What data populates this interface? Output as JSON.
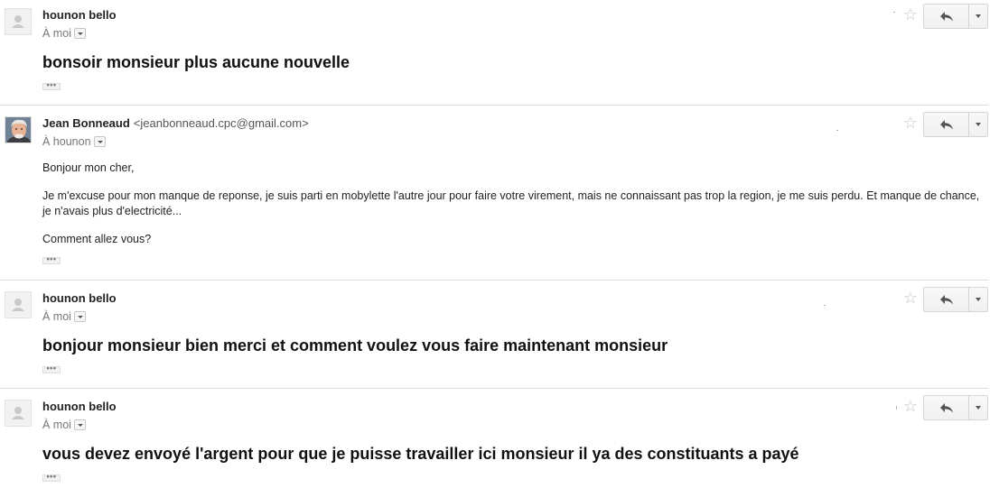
{
  "messages": [
    {
      "sender_name": "hounon bello",
      "sender_email": "",
      "recipient": "À moi",
      "body_large": "bonsoir monsieur plus aucune nouvelle",
      "avatar_type": "default-person-icon"
    },
    {
      "sender_name": "Jean Bonneaud",
      "sender_email": "<jeanbonneaud.cpc@gmail.com>",
      "recipient": "À hounon",
      "body_paragraphs": [
        "Bonjour mon cher,",
        "Je m'excuse pour mon manque de reponse, je suis parti en mobylette l'autre jour pour faire votre virement, mais ne connaissant pas trop la region, je me suis perdu. Et manque de chance, je n'avais plus d'electricité...",
        "Comment allez vous?"
      ],
      "avatar_type": "photo"
    },
    {
      "sender_name": "hounon bello",
      "sender_email": "",
      "recipient": "À moi",
      "body_large": "bonjour monsieur bien merci et comment voulez vous faire maintenant monsieur",
      "avatar_type": "default-person-icon"
    },
    {
      "sender_name": "hounon bello",
      "sender_email": "",
      "recipient": "À moi",
      "body_large": "vous devez envoyé l'argent pour que je puisse travailler ici monsieur il ya des constituants a payé",
      "avatar_type": "default-person-icon"
    }
  ],
  "icons": {
    "star": "☆",
    "reply": "reply-icon",
    "more": "chevron-down-icon",
    "show_trimmed": "•••"
  },
  "colors": {
    "separator": "#dcdcdc",
    "star": "#c4c4c4",
    "meta_text": "#777777"
  }
}
